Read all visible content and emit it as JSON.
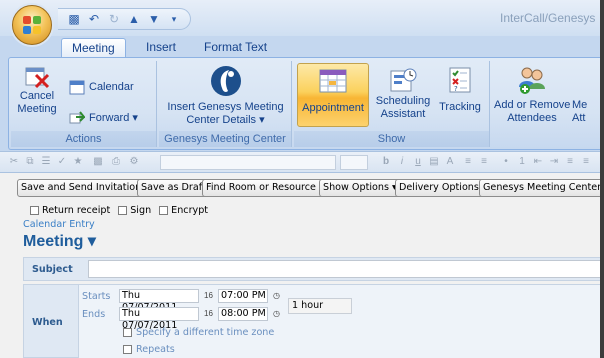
{
  "window": {
    "title": "InterCall/Genesys"
  },
  "tabs": [
    "Meeting",
    "Insert",
    "Format Text"
  ],
  "ribbon": {
    "actions": {
      "label": "Actions",
      "cancel_line1": "Cancel",
      "cancel_line2": "Meeting",
      "calendar": "Calendar",
      "forward": "Forward ▾"
    },
    "genesys": {
      "label": "Genesys Meeting Center",
      "insert_line1": "Insert Genesys Meeting",
      "insert_line2": "Center Details ▾"
    },
    "show": {
      "label": "Show",
      "appointment": "Appointment",
      "scheduling_line1": "Scheduling",
      "scheduling_line2": "Assistant",
      "tracking": "Tracking"
    },
    "attendees": {
      "addremove_line1": "Add or Remove",
      "addremove_line2": "Attendees",
      "partial_line1": "Me",
      "partial_line2": "Att"
    }
  },
  "commands": [
    "Save and Send Invitations",
    "Save as Draft",
    "Find Room or Resource ▾",
    "Show Options ▾",
    "Delivery Options...",
    "Genesys Meeting Center"
  ],
  "checkboxes": [
    "Return receipt",
    "Sign",
    "Encrypt"
  ],
  "entry": {
    "type": "Calendar Entry",
    "title": "Meeting ▾"
  },
  "subject": {
    "label": "Subject",
    "value": ""
  },
  "when": {
    "label": "When",
    "starts_label": "Starts",
    "starts_date": "Thu 07/07/2011",
    "starts_time": "07:00 PM",
    "ends_label": "Ends",
    "ends_date": "Thu 07/07/2011",
    "ends_time": "08:00 PM",
    "duration": "1 hour",
    "timezone_option": "Specify a different time zone",
    "repeats_option": "Repeats"
  }
}
